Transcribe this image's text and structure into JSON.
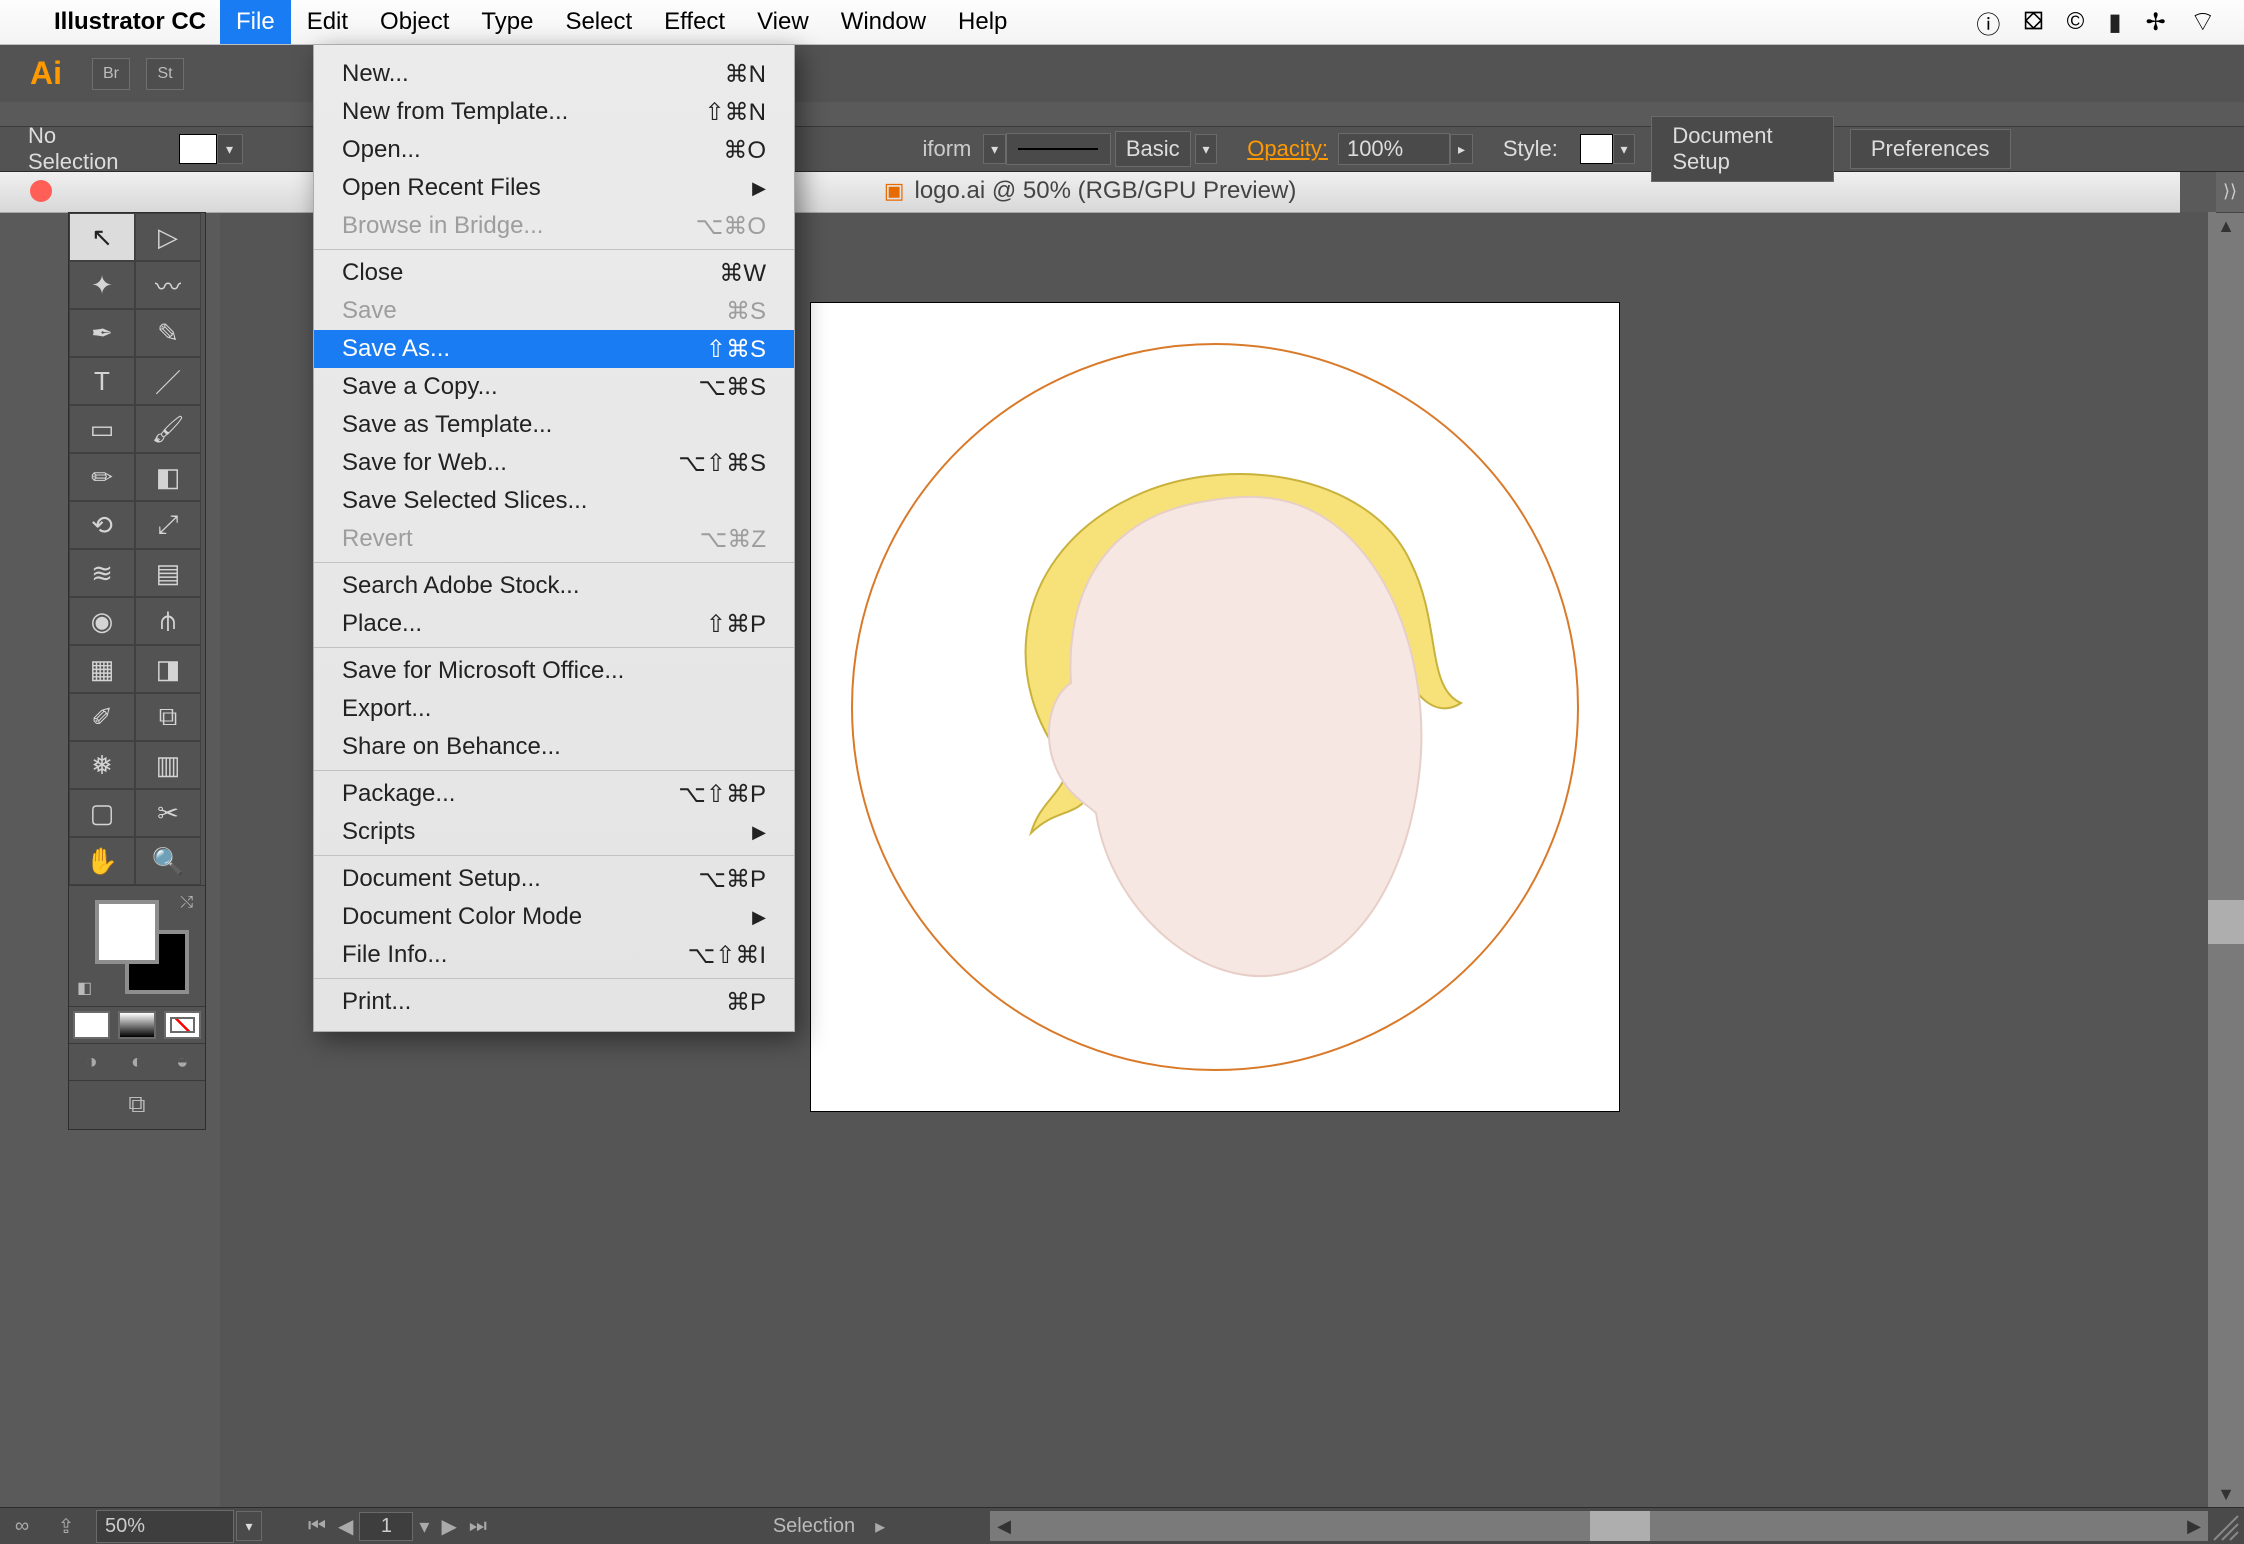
{
  "menubar": {
    "app": "Illustrator CC",
    "items": [
      "File",
      "Edit",
      "Object",
      "Type",
      "Select",
      "Effect",
      "View",
      "Window",
      "Help"
    ],
    "open_index": 0
  },
  "appstrip": {
    "small1": "Br",
    "small2": "St"
  },
  "ctrlbar": {
    "no_selection": "No Selection",
    "iform": "iform",
    "basic": "Basic",
    "opacity_label": "Opacity:",
    "opacity_value": "100%",
    "style_label": "Style:",
    "doc_setup": "Document Setup",
    "prefs": "Preferences"
  },
  "tab": {
    "title": "logo.ai @ 50% (RGB/GPU Preview)"
  },
  "file_menu": {
    "groups": [
      [
        {
          "label": "New...",
          "shortcut": "⌘N"
        },
        {
          "label": "New from Template...",
          "shortcut": "⇧⌘N"
        },
        {
          "label": "Open...",
          "shortcut": "⌘O"
        },
        {
          "label": "Open Recent Files",
          "submenu": true
        },
        {
          "label": "Browse in Bridge...",
          "shortcut": "⌥⌘O",
          "disabled": true
        }
      ],
      [
        {
          "label": "Close",
          "shortcut": "⌘W"
        },
        {
          "label": "Save",
          "shortcut": "⌘S",
          "disabled": true
        },
        {
          "label": "Save As...",
          "shortcut": "⇧⌘S",
          "selected": true
        },
        {
          "label": "Save a Copy...",
          "shortcut": "⌥⌘S"
        },
        {
          "label": "Save as Template..."
        },
        {
          "label": "Save for Web...",
          "shortcut": "⌥⇧⌘S"
        },
        {
          "label": "Save Selected Slices..."
        },
        {
          "label": "Revert",
          "shortcut": "⌥⌘Z",
          "disabled": true
        }
      ],
      [
        {
          "label": "Search Adobe Stock..."
        },
        {
          "label": "Place...",
          "shortcut": "⇧⌘P"
        }
      ],
      [
        {
          "label": "Save for Microsoft Office..."
        },
        {
          "label": "Export..."
        },
        {
          "label": "Share on Behance..."
        }
      ],
      [
        {
          "label": "Package...",
          "shortcut": "⌥⇧⌘P"
        },
        {
          "label": "Scripts",
          "submenu": true
        }
      ],
      [
        {
          "label": "Document Setup...",
          "shortcut": "⌥⌘P"
        },
        {
          "label": "Document Color Mode",
          "submenu": true
        },
        {
          "label": "File Info...",
          "shortcut": "⌥⇧⌘I"
        }
      ],
      [
        {
          "label": "Print...",
          "shortcut": "⌘P"
        }
      ]
    ]
  },
  "status": {
    "zoom": "50%",
    "page": "1",
    "tool": "Selection"
  },
  "tools": {
    "rows": [
      [
        "selection",
        "direct-selection"
      ],
      [
        "magic-wand",
        "lasso"
      ],
      [
        "pen",
        "curvature"
      ],
      [
        "type",
        "line"
      ],
      [
        "rectangle",
        "paintbrush"
      ],
      [
        "pencil",
        "eraser"
      ],
      [
        "rotate",
        "scale"
      ],
      [
        "width",
        "free-transform"
      ],
      [
        "shape-builder",
        "perspective"
      ],
      [
        "mesh",
        "gradient"
      ],
      [
        "eyedropper",
        "blend"
      ],
      [
        "symbol-sprayer",
        "column-graph"
      ],
      [
        "artboard",
        "slice"
      ],
      [
        "hand",
        "zoom"
      ]
    ]
  }
}
